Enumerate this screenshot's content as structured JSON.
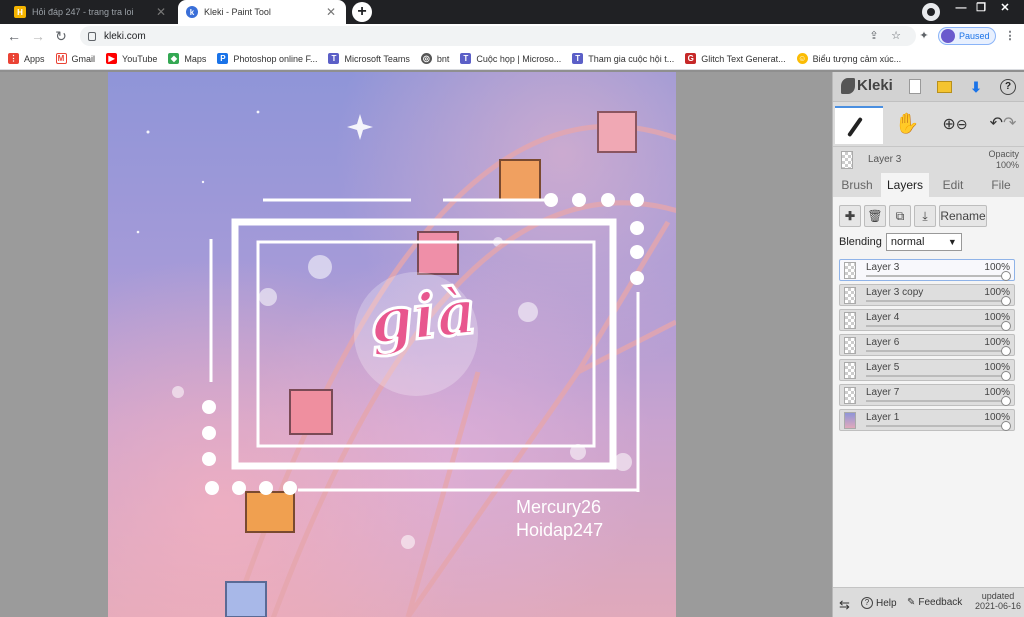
{
  "browser": {
    "tabs": [
      {
        "title": "Hỏi đáp 247 - trang tra loi",
        "active": false,
        "favicon": "H"
      },
      {
        "title": "Kleki - Paint Tool",
        "active": true,
        "favicon": "k"
      }
    ],
    "new_tab": "+",
    "url": "kleki.com",
    "profile_status": "Paused"
  },
  "bookmarks": [
    {
      "label": "Apps",
      "icon": "apps-grid-icon",
      "color": "#ea4335"
    },
    {
      "label": "Gmail",
      "icon": "gmail-icon",
      "color": "#ea4335"
    },
    {
      "label": "YouTube",
      "icon": "youtube-icon",
      "color": "#ff0000"
    },
    {
      "label": "Maps",
      "icon": "maps-icon",
      "color": "#34a853"
    },
    {
      "label": "Photoshop online F...",
      "icon": "photoshop-icon",
      "color": "#1a73e8"
    },
    {
      "label": "Microsoft Teams",
      "icon": "teams-icon",
      "color": "#5b5fc7"
    },
    {
      "label": "bnt",
      "icon": "globe-icon",
      "color": "#555555"
    },
    {
      "label": "Cuộc họp | Microso...",
      "icon": "teams-icon",
      "color": "#5b5fc7"
    },
    {
      "label": "Tham gia cuộc hội t...",
      "icon": "teams-icon",
      "color": "#5b5fc7"
    },
    {
      "label": "Glitch Text Generat...",
      "icon": "glitch-icon",
      "color": "#c62828"
    },
    {
      "label": "Biểu tượng cảm xúc...",
      "icon": "emoji-icon",
      "color": "#fbbc04"
    }
  ],
  "canvas": {
    "sticker_text": "già",
    "watermark_line1": "Mercury26",
    "watermark_line2": "Hoidap247"
  },
  "kleki": {
    "logo": "Kleki",
    "current_layer": "Layer 3",
    "opacity_label": "Opacity",
    "opacity_value": "100%",
    "tabs": [
      {
        "label": "Brush",
        "active": false
      },
      {
        "label": "Layers",
        "active": true
      },
      {
        "label": "Edit",
        "active": false
      },
      {
        "label": "File",
        "active": false
      }
    ],
    "rename_label": "Rename",
    "blending_label": "Blending",
    "blending_value": "normal",
    "layers": [
      {
        "name": "Layer 3",
        "opacity": "100%",
        "selected": true
      },
      {
        "name": "Layer 3 copy",
        "opacity": "100%",
        "selected": false
      },
      {
        "name": "Layer 4",
        "opacity": "100%",
        "selected": false
      },
      {
        "name": "Layer 6",
        "opacity": "100%",
        "selected": false
      },
      {
        "name": "Layer 5",
        "opacity": "100%",
        "selected": false
      },
      {
        "name": "Layer 7",
        "opacity": "100%",
        "selected": false
      },
      {
        "name": "Layer 1",
        "opacity": "100%",
        "selected": false
      }
    ],
    "footer": {
      "help": "Help",
      "feedback": "Feedback",
      "updated_label": "updated",
      "updated_date": "2021-06-16"
    }
  },
  "colors": {
    "accent": "#4a8fe0",
    "sticker_pink": "#e8578e"
  }
}
